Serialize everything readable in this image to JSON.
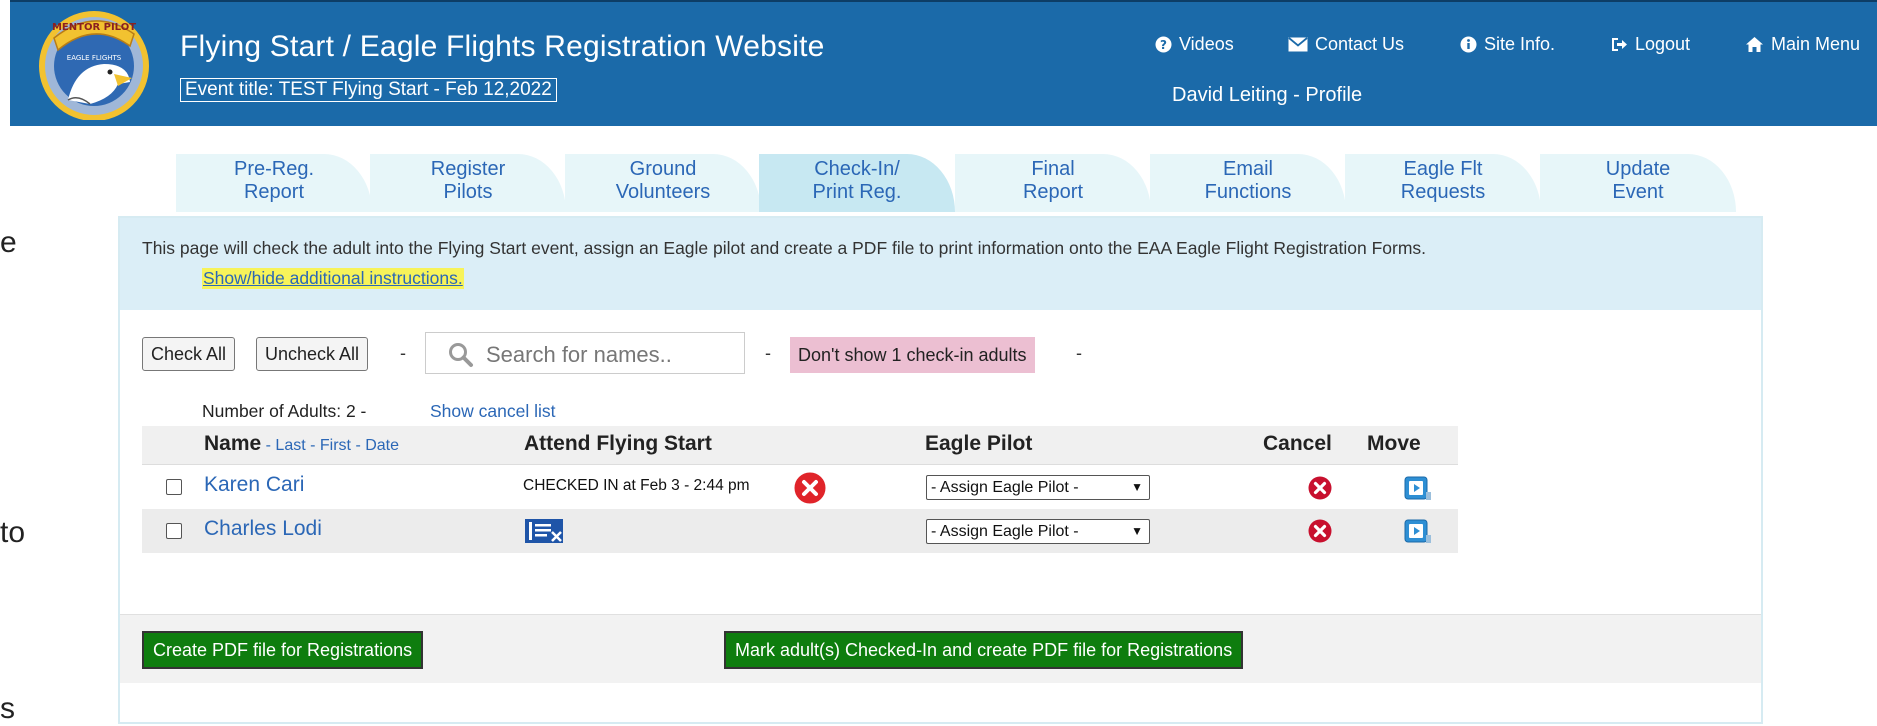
{
  "header": {
    "app_title": "Flying Start / Eagle Flights Registration Website",
    "event_title": "Event title: TEST Flying Start - Feb 12,2022",
    "logo_text": "MENTOR PILOT",
    "logo_subtext": "EAGLE FLIGHTS",
    "nav": {
      "videos": "Videos",
      "contact": "Contact Us",
      "site_info": "Site Info.",
      "logout": "Logout",
      "main_menu": "Main Menu"
    },
    "profile": "David Leiting - Profile"
  },
  "side_fragments": [
    "e",
    "to",
    "s"
  ],
  "tabs": [
    {
      "line1": "Pre-Reg.",
      "line2": "Report"
    },
    {
      "line1": "Register",
      "line2": "Pilots"
    },
    {
      "line1": "Ground",
      "line2": "Volunteers"
    },
    {
      "line1": "Check-In/",
      "line2": "Print Reg."
    },
    {
      "line1": "Final",
      "line2": "Report"
    },
    {
      "line1": "Email",
      "line2": "Functions"
    },
    {
      "line1": "Eagle Flt",
      "line2": "Requests"
    },
    {
      "line1": "Update",
      "line2": "Event"
    }
  ],
  "main": {
    "info_text": "This page will check the adult into the Flying Start event, assign an Eagle pilot and create a PDF file to print information onto the EAA Eagle Flight Registration Forms.",
    "instructions_link": "Show/hide additional instructions.",
    "check_all": "Check All",
    "uncheck_all": "Uncheck All",
    "dash": "-",
    "search_placeholder": "Search for names..",
    "dont_show": "Don't show 1 check-in adults",
    "count": "Number of Adults: 2 -",
    "show_cancel": "Show cancel list"
  },
  "table": {
    "col_name": "Name",
    "sort_sep1": " - ",
    "sort_last": "Last",
    "sort_sep2": " - ",
    "sort_first": "First",
    "sort_sep3": " - ",
    "sort_date": "Date",
    "col_attend": "Attend Flying Start",
    "col_pilot": "Eagle Pilot",
    "col_cancel": "Cancel",
    "col_move": "Move",
    "rows": [
      {
        "name": "Karen Cari",
        "attend": "CHECKED IN at Feb 3 - 2:44 pm",
        "pilot": "- Assign Eagle Pilot -"
      },
      {
        "name": "Charles Lodi",
        "attend": "",
        "pilot": "- Assign Eagle Pilot -"
      }
    ]
  },
  "bottom": {
    "create_pdf": "Create PDF file for Registrations",
    "mark_checked": "Mark adult(s) Checked-In and create PDF file for Registrations"
  },
  "colors": {
    "header_blue": "#1b6aa9",
    "link_blue": "#2b67b6",
    "green_button": "#0e7d0e",
    "pink_badge": "#ecbfd2",
    "highlight_yellow": "#f7f35a",
    "cancel_red": "#c8102e"
  },
  "icons": [
    "question-circle-icon",
    "envelope-icon",
    "info-circle-icon",
    "logout-icon",
    "home-icon",
    "search-icon",
    "uncheck-x-icon",
    "checkin-card-icon",
    "cancel-icon",
    "move-icon"
  ]
}
